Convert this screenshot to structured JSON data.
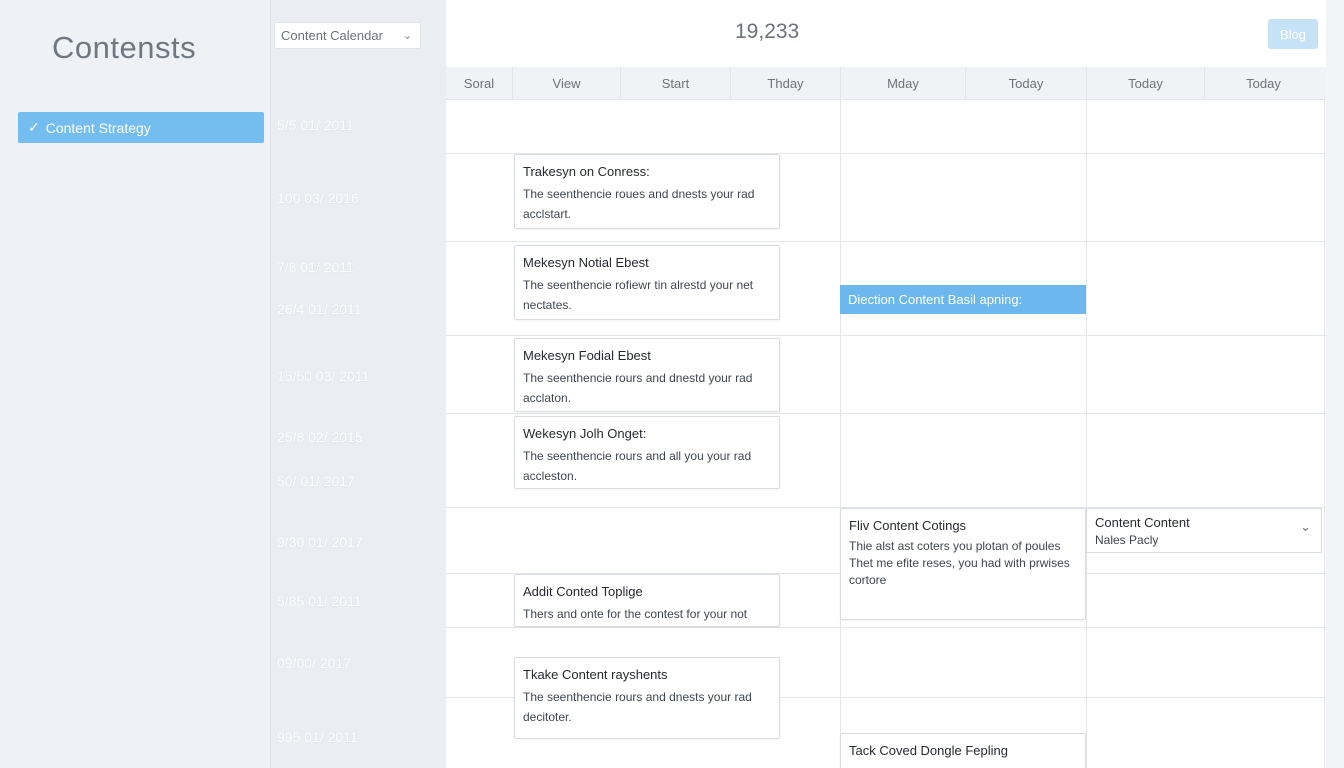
{
  "sidebar": {
    "title": "Contensts",
    "items": [
      {
        "label": "Content Strategy",
        "selected": true,
        "icon": "check-icon"
      }
    ]
  },
  "calendar": {
    "view_select": "Content Calendar",
    "count": "19,233",
    "blog_button": "Blog",
    "columns": [
      "Soral",
      "View",
      "Start",
      "Thday",
      "Mday",
      "Today",
      "Today",
      "Today"
    ],
    "dates": [
      "5/5 01/ 2011",
      "100 03/ 2016",
      "7/8 01/ 2011",
      "26/4 01/ 2011",
      "15/50 03/ 2011",
      "25/8 02/ 2015",
      "50/ 01/ 2017",
      "9/30 01/ 2017",
      "5/85 01/ 2011",
      "09/00/ 2017",
      "995 01/ 2011"
    ]
  },
  "events": [
    {
      "title": "Trakesyn on Conress:",
      "desc": "The seenthencie roues and dnests your rad acclstart."
    },
    {
      "title": "Mekesyn Notial Ebest",
      "desc": "The seenthencie rofiewr tin alrestd your net nectates."
    },
    {
      "title": "Mekesyn Fodial Ebest",
      "desc": "The seenthencie rours and dnestd your rad acclaton."
    },
    {
      "title": "Wekesyn Jolh Onget:",
      "desc": "The seenthencie rours and all you your rad accleston."
    },
    {
      "title": "Addit Conted Toplige",
      "desc": "Thers and onte for the contest for your not"
    },
    {
      "title": "Tkake Content rayshents",
      "desc": "The seenthencie rours and dnests your rad decitoter."
    },
    {
      "title": "Fliv Content Cotings",
      "desc": "Thie alst ast coters you plotan of poules Thet me efite reses, you had with prwises cortore"
    },
    {
      "title": "Tack Coved Dongle Fepling",
      "desc": ""
    }
  ],
  "blue_event": "Diection Content Basil apning:",
  "dropdown_card": {
    "title": "Content Content",
    "subtitle": "Nales Pacly"
  }
}
